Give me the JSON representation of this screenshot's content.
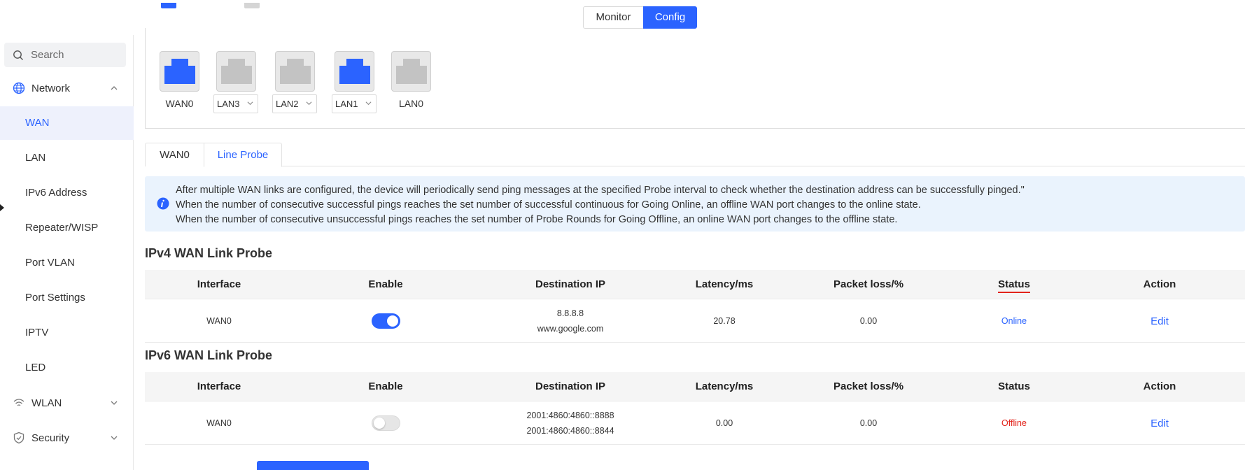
{
  "top_switch": {
    "monitor_label": "Monitor",
    "config_label": "Config",
    "active": "Config"
  },
  "sidebar": {
    "search_placeholder": "Search",
    "network_label": "Network",
    "items": [
      {
        "label": "WAN",
        "active": true
      },
      {
        "label": "LAN"
      },
      {
        "label": "IPv6 Address"
      },
      {
        "label": "Repeater/WISP"
      },
      {
        "label": "Port VLAN"
      },
      {
        "label": "Port Settings"
      },
      {
        "label": "IPTV"
      },
      {
        "label": "LED"
      }
    ],
    "wlan_label": "WLAN",
    "security_label": "Security"
  },
  "ports": [
    {
      "label": "WAN0",
      "active": true,
      "type": "static"
    },
    {
      "label": "LAN3",
      "active": false,
      "type": "select"
    },
    {
      "label": "LAN2",
      "active": false,
      "type": "select"
    },
    {
      "label": "LAN1",
      "active": true,
      "type": "select"
    },
    {
      "label": "LAN0",
      "active": false,
      "type": "static"
    }
  ],
  "tabs": {
    "tab1": "WAN0",
    "tab2": "Line Probe",
    "active": "Line Probe"
  },
  "info": {
    "line1": "After multiple WAN links are configured, the device will periodically send ping messages at the specified Probe interval to check whether the destination address can be successfully pinged.\"",
    "line2": "When the number of consecutive successful pings reaches the set number of successful continuous for Going Online, an offline WAN port changes to the online state.",
    "line3": "When the number of consecutive unsuccessful pings reaches the set number of Probe Rounds for Going Offline, an online WAN port changes to the offline state."
  },
  "columns": {
    "interface": "Interface",
    "enable": "Enable",
    "destination_ip": "Destination IP",
    "latency": "Latency/ms",
    "packet_loss": "Packet loss/%",
    "status": "Status",
    "action": "Action"
  },
  "ipv4": {
    "title": "IPv4 WAN Link Probe",
    "row": {
      "interface": "WAN0",
      "enabled": true,
      "dest1": "8.8.8.8",
      "dest2": "www.google.com",
      "latency": "20.78",
      "packet_loss": "0.00",
      "status": "Online",
      "action": "Edit"
    }
  },
  "ipv6": {
    "title": "IPv6 WAN Link Probe",
    "row": {
      "interface": "WAN0",
      "enabled": false,
      "dest1": "2001:4860:4860::8888",
      "dest2": "2001:4860:4860::8844",
      "latency": "0.00",
      "packet_loss": "0.00",
      "status": "Offline",
      "action": "Edit"
    }
  },
  "colors": {
    "accent": "#2b63ff",
    "offline": "#e2231a",
    "info_bg": "#eaf3fd"
  },
  "icons": [
    "search-icon",
    "globe-icon",
    "chevron-up-icon",
    "wifi-icon",
    "chevron-down-icon",
    "shield-icon",
    "info-icon",
    "ethernet-port-icon"
  ]
}
